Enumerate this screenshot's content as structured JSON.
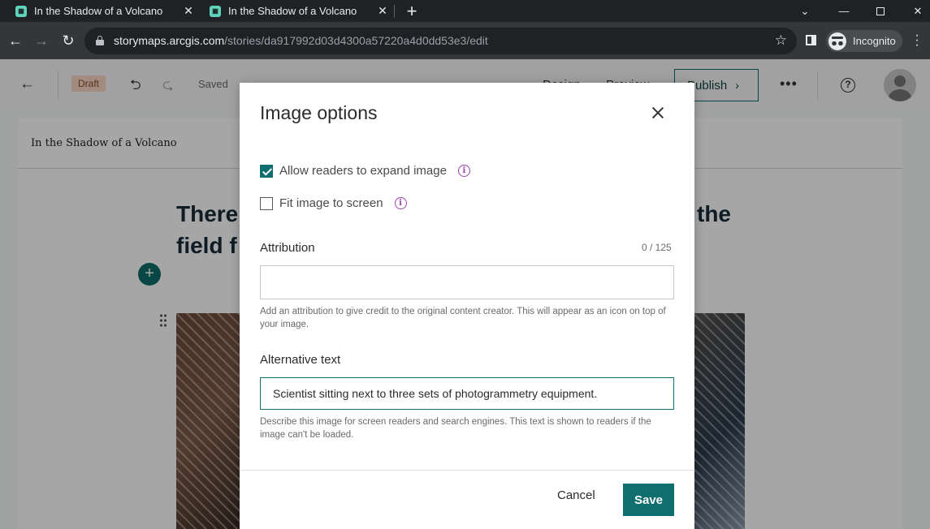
{
  "browser": {
    "tabs": [
      {
        "title": "In the Shadow of a Volcano",
        "icon": "storymaps-favicon"
      },
      {
        "title": "In the Shadow of a Volcano",
        "icon": "storymaps-favicon"
      }
    ],
    "url_host": "storymaps.arcgis.com",
    "url_path": "/stories/da917992d03d4300a57220a4d0dd53e3/edit",
    "profile_label": "Incognito"
  },
  "app_header": {
    "status_badge": "Draft",
    "save_status": "Saved",
    "design_label": "Design",
    "preview_label": "Preview",
    "publish_label": "Publish"
  },
  "story": {
    "header_title": "In the Shadow of a Volcano",
    "heading_start": "There",
    "heading_end": "the",
    "heading_line2": "field f"
  },
  "modal": {
    "title": "Image options",
    "expand_label": "Allow readers to expand image",
    "expand_checked": true,
    "fit_label": "Fit image to screen",
    "fit_checked": false,
    "attribution_label": "Attribution",
    "attribution_counter": "0 / 125",
    "attribution_value": "",
    "attribution_help": "Add an attribution to give credit to the original content creator. This will appear as an icon on top of your image.",
    "alt_label": "Alternative text",
    "alt_value": "Scientist sitting next to three sets of photogrammetry equipment.",
    "alt_help": "Describe this image for screen readers and search engines. This text is shown to readers if the image can't be loaded.",
    "cancel_label": "Cancel",
    "save_label": "Save"
  },
  "colors": {
    "accent": "#0f6e6e",
    "info": "#9b3fb0"
  }
}
